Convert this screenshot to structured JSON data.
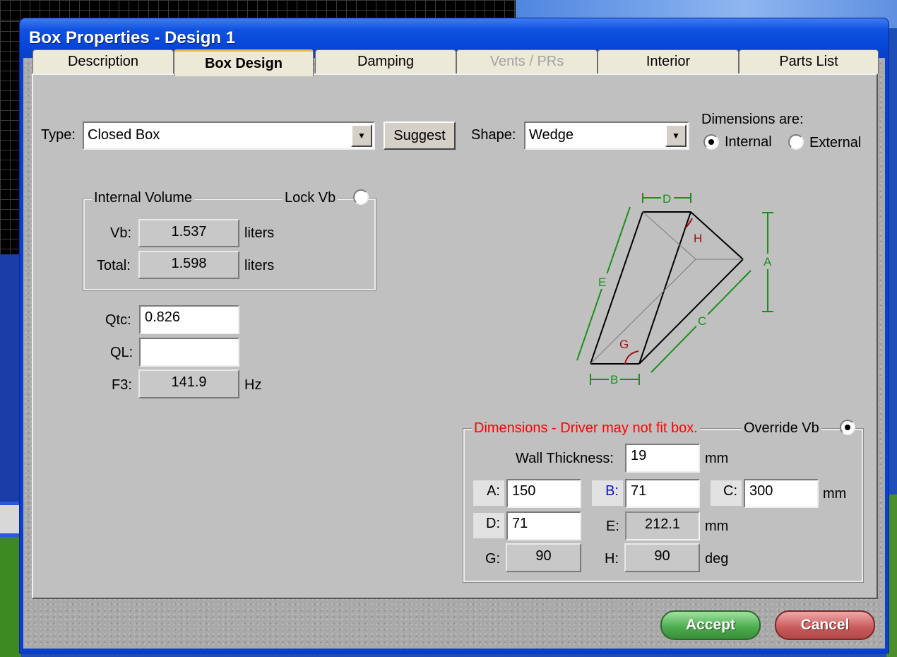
{
  "window": {
    "title": "Box Properties - Design 1"
  },
  "tabs": [
    {
      "label": "Description",
      "state": "normal"
    },
    {
      "label": "Box Design",
      "state": "active"
    },
    {
      "label": "Damping",
      "state": "normal"
    },
    {
      "label": "Vents / PRs",
      "state": "disabled"
    },
    {
      "label": "Interior",
      "state": "normal"
    },
    {
      "label": "Parts List",
      "state": "normal"
    }
  ],
  "type": {
    "label": "Type:",
    "value": "Closed Box",
    "suggest_label": "Suggest"
  },
  "shape": {
    "label": "Shape:",
    "value": "Wedge"
  },
  "dimensions_are": {
    "label": "Dimensions are:",
    "internal_label": "Internal",
    "external_label": "External",
    "selected": "Internal"
  },
  "internal_volume": {
    "group_label": "Internal Volume",
    "lock_label": "Lock Vb",
    "vb_label": "Vb:",
    "vb_value": "1.537",
    "vb_unit": "liters",
    "total_label": "Total:",
    "total_value": "1.598",
    "total_unit": "liters"
  },
  "params": {
    "qtc_label": "Qtc:",
    "qtc_value": "0.826",
    "ql_label": "QL:",
    "ql_value": "",
    "f3_label": "F3:",
    "f3_value": "141.9",
    "f3_unit": "Hz"
  },
  "diagram": {
    "labels": {
      "d": "D",
      "h": "H",
      "a": "A",
      "e": "E",
      "c": "C",
      "g": "G",
      "b": "B"
    },
    "line_color": "#1a8f1a",
    "angle_color": "#a01010"
  },
  "dimensions": {
    "group_label": "Dimensions - Driver may not fit box.",
    "warning_color": "#ff0000",
    "override_label": "Override Vb",
    "wall_label": "Wall Thickness:",
    "wall_value": "19",
    "wall_unit": "mm",
    "a_label": "A:",
    "a_value": "150",
    "b_label": "B:",
    "b_value": "71",
    "c_label": "C:",
    "c_value": "300",
    "abc_unit": "mm",
    "d_label": "D:",
    "d_value": "71",
    "e_label": "E:",
    "e_value": "212.1",
    "de_unit": "mm",
    "g_label": "G:",
    "g_value": "90",
    "h_label": "H:",
    "h_value": "90",
    "gh_unit": "deg"
  },
  "footer": {
    "accept_label": "Accept",
    "cancel_label": "Cancel"
  }
}
